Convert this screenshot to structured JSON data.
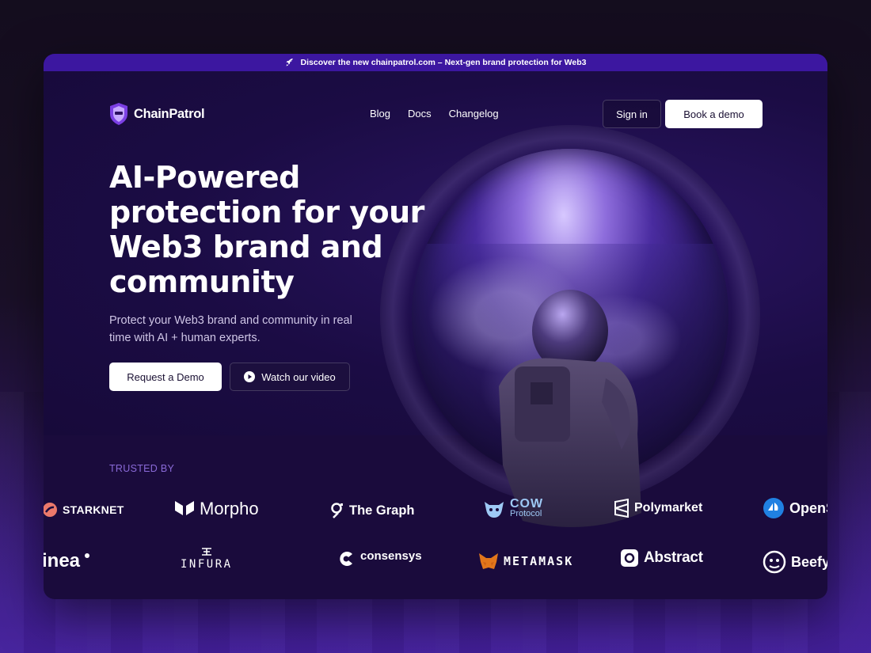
{
  "announcement": {
    "text": "Discover the new chainpatrol.com – Next-gen brand protection for Web3",
    "icon": "rocket-icon"
  },
  "nav": {
    "brand": "ChainPatrol",
    "links": [
      "Blog",
      "Docs",
      "Changelog"
    ],
    "sign_in": "Sign in",
    "book_demo": "Book a demo"
  },
  "hero": {
    "headline_lines": [
      "AI-Powered",
      "protection for your",
      "Web3 brand and",
      "community"
    ],
    "subtitle": "Protect your Web3 brand and community in real time with AI + human experts.",
    "cta_primary": "Request a Demo",
    "cta_video": "Watch our video"
  },
  "trusted": {
    "label": "TRUSTED BY",
    "row1": [
      "STARKNET",
      "Morpho",
      "The Graph",
      "COW",
      "Protocol",
      "Polymarket",
      "OpenS"
    ],
    "row2": [
      "inea",
      "INFURA",
      "consensys",
      "METAMASK",
      "Abstract",
      "Beefy"
    ]
  },
  "colors": {
    "accent": "#3c17a0",
    "background": "#1a0b3c",
    "trusted_label": "#8a6ad8"
  }
}
